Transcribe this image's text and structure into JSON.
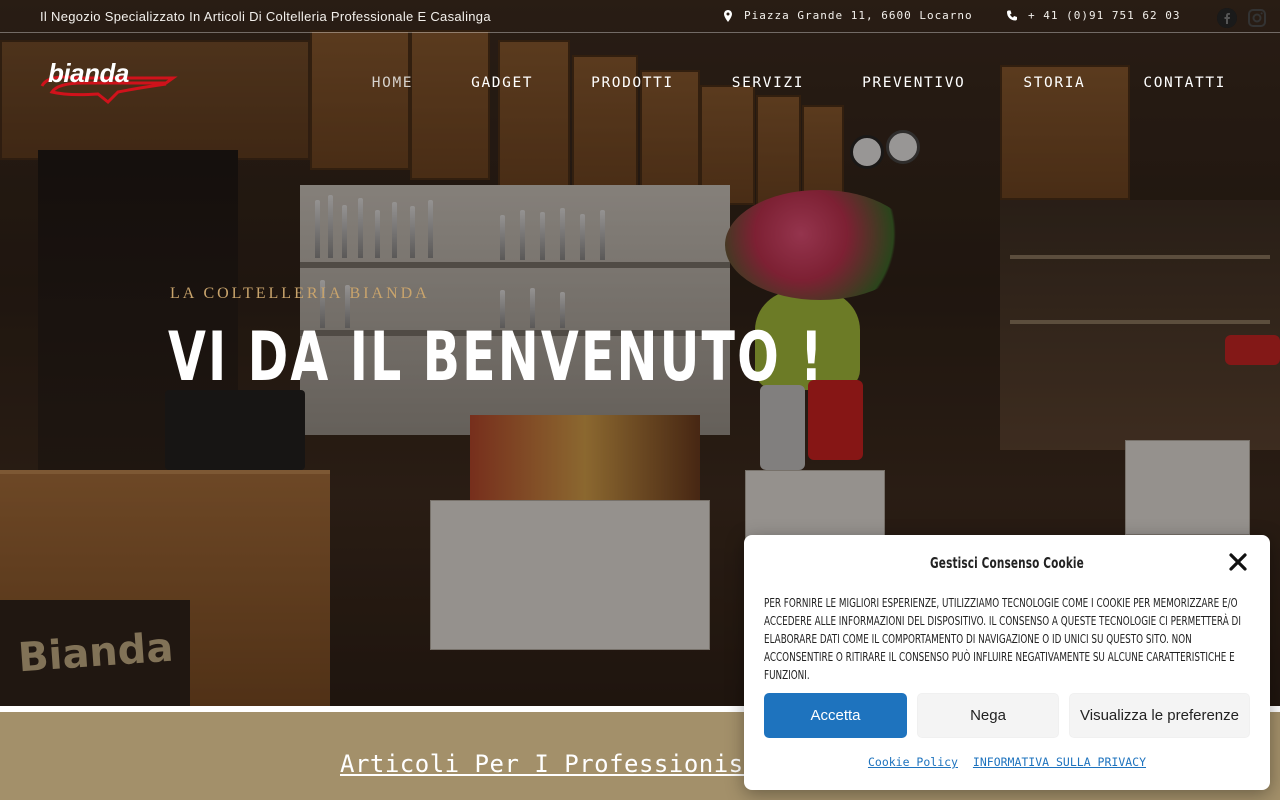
{
  "topbar": {
    "tagline": "Il Negozio Specializzato In Articoli Di Coltelleria Professionale E Casalinga",
    "address": "Piazza Grande 11, 6600 Locarno",
    "phone": "+ 41 (0)91 751 62 03"
  },
  "logo": {
    "text": "bianda"
  },
  "nav": {
    "items": [
      {
        "label": "HOME"
      },
      {
        "label": "GADGET"
      },
      {
        "label": "PRODOTTI"
      },
      {
        "label": "SERVIZI"
      },
      {
        "label": "PREVENTIVO"
      },
      {
        "label": "STORIA"
      },
      {
        "label": "CONTATTI"
      }
    ]
  },
  "hero": {
    "eyebrow": "LA COLTELLERIA BIANDA",
    "headline": "VI DA IL BENVENUTO !",
    "sign_text": "Bianda"
  },
  "section": {
    "title": "Articoli Per I Professionisti"
  },
  "cookie": {
    "title": "Gestisci Consenso Cookie",
    "body": "Per fornire le migliori esperienze, utilizziamo tecnologie come i cookie per memorizzare e/o accedere alle informazioni del dispositivo. Il consenso a queste tecnologie ci permetterà di elaborare dati come il comportamento di navigazione o ID unici su questo sito. Non acconsentire o ritirare il consenso può influire negativamente su alcune caratteristiche e funzioni.",
    "accept": "Accetta",
    "deny": "Nega",
    "preferences": "Visualizza le preferenze",
    "link_policy": "Cookie Policy",
    "link_privacy": "INFORMATIVA SULLA PRIVACY"
  },
  "colors": {
    "accent_blue": "#1e73be",
    "band_tan": "#a3906a",
    "eyebrow_gold": "#c9a46c",
    "logo_red": "#d0121b"
  }
}
